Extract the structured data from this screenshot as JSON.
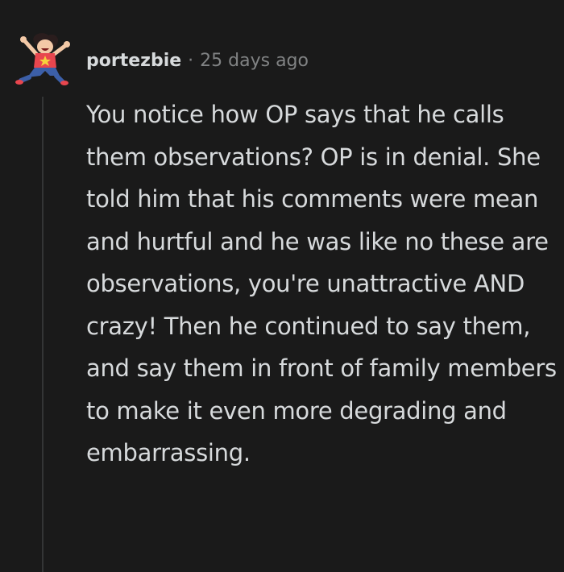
{
  "comment": {
    "author": "portezbie",
    "separator": "·",
    "timestamp": "25 days ago",
    "avatar_icon": "cartoon-character-avatar-icon",
    "body": "You notice how OP says that he calls them observations? OP is in denial. She told him that his comments were mean and hurtful and he was like no these are observations, you're unattractive AND crazy! Then he continued to say them, and say them in front of family members to make it even more degrading and embarrassing."
  },
  "colors": {
    "background": "#1a1a1a",
    "text": "#d7dadc",
    "meta": "#818384",
    "thread_line": "#343536"
  }
}
